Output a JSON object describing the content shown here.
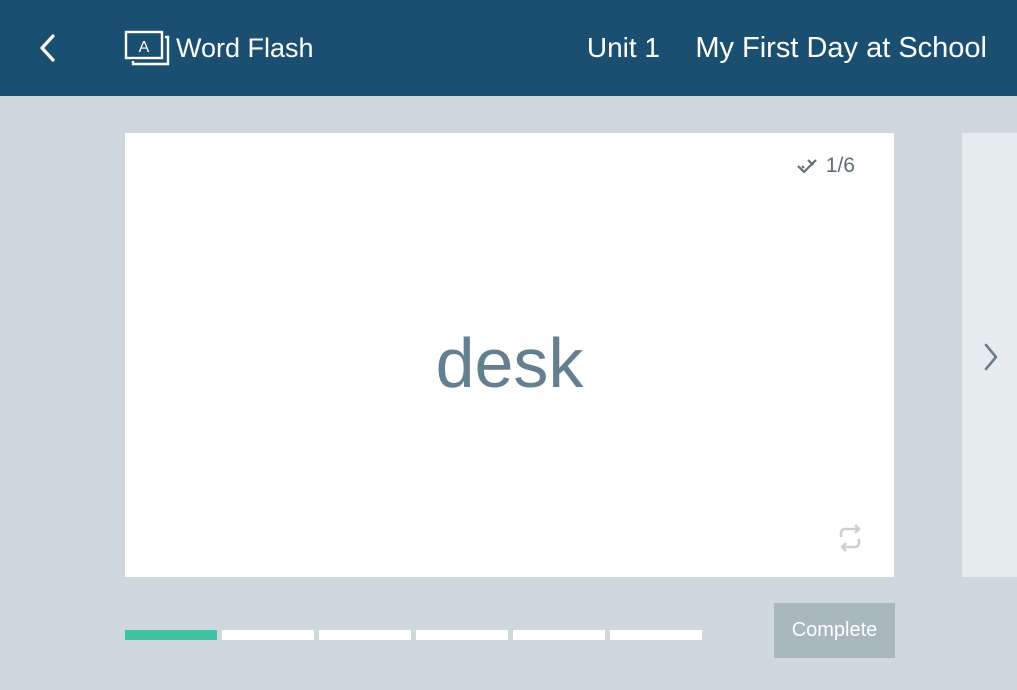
{
  "header": {
    "app_name": "Word Flash",
    "unit": "Unit 1",
    "lesson_title": "My First Day at School",
    "background_color": "#1a4f72"
  },
  "card": {
    "progress_text": "1/6",
    "word": "desk"
  },
  "progress": {
    "total": 6,
    "completed": 1,
    "done_color": "#3cc4a3"
  },
  "actions": {
    "complete_label": "Complete"
  },
  "icons": {
    "back": "chevron-left-icon",
    "logo": "flashcard-logo-icon",
    "check": "double-check-icon",
    "flip": "flip-arrows-icon",
    "next": "chevron-right-icon"
  }
}
